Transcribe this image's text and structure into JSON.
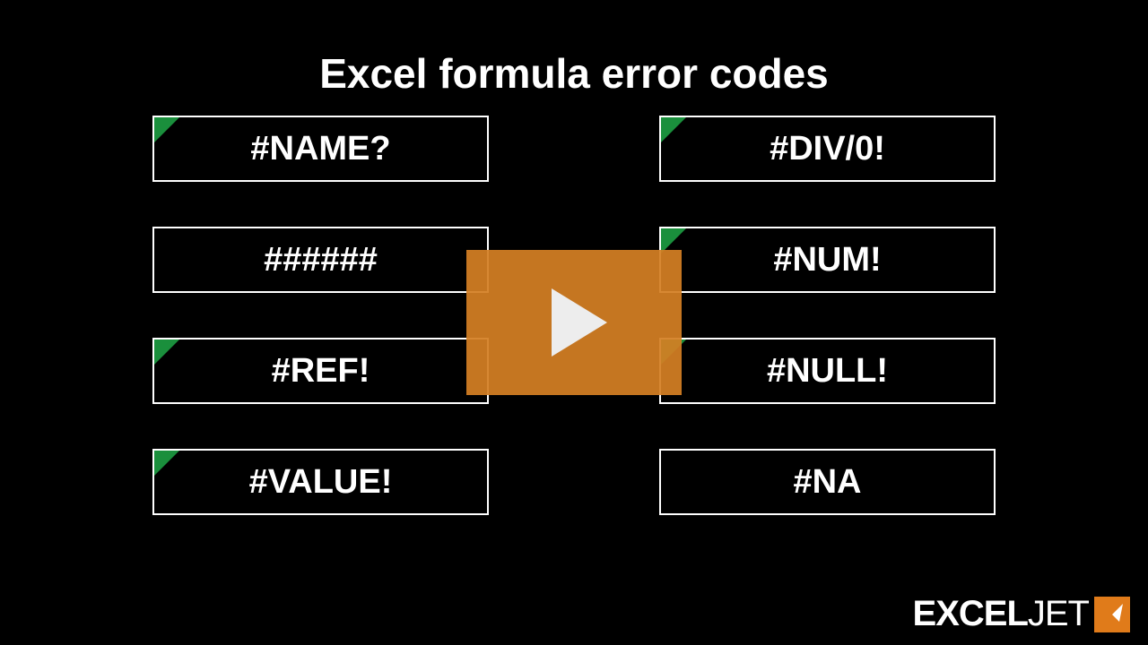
{
  "title": "Excel formula error codes",
  "cells": [
    {
      "label": "#NAME?",
      "flag": true
    },
    {
      "label": "#DIV/0!",
      "flag": true
    },
    {
      "label": "######",
      "flag": false
    },
    {
      "label": "#NUM!",
      "flag": true
    },
    {
      "label": "#REF!",
      "flag": true
    },
    {
      "label": "#NULL!",
      "flag": true
    },
    {
      "label": "#VALUE!",
      "flag": true
    },
    {
      "label": "#NA",
      "flag": false
    }
  ],
  "logo": {
    "bold": "EXCEL",
    "thin": "JET"
  },
  "colors": {
    "flag": "#1a8f3c",
    "play": "#d47f24",
    "logoIcon": "#e07b1a"
  }
}
